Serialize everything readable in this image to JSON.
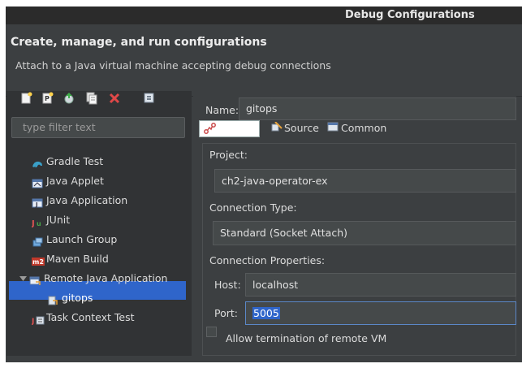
{
  "window": {
    "title": "Debug Configurations"
  },
  "header": {
    "title": "Create, manage, and run configurations",
    "subtitle": "Attach to a Java virtual machine accepting debug connections"
  },
  "toolbar": {
    "icons": [
      "new-configuration-icon",
      "new-prototype-icon",
      "export-icon",
      "duplicate-icon",
      "delete-icon",
      "collapse-all-icon"
    ],
    "delete_color": "#e04848"
  },
  "filter": {
    "placeholder": "type filter text"
  },
  "tree": {
    "items": [
      {
        "label": "Gradle Test",
        "icon": "gradle-icon"
      },
      {
        "label": "Java Applet",
        "icon": "java-applet-icon"
      },
      {
        "label": "Java Application",
        "icon": "java-application-icon"
      },
      {
        "label": "JUnit",
        "icon": "junit-icon"
      },
      {
        "label": "Launch Group",
        "icon": "launch-group-icon"
      },
      {
        "label": "Maven Build",
        "icon": "maven-icon"
      },
      {
        "label": "Remote Java Application",
        "icon": "remote-java-icon"
      },
      {
        "label": "gitops",
        "icon": "remote-config-icon"
      },
      {
        "label": "Task Context Test",
        "icon": "task-context-icon"
      }
    ]
  },
  "form": {
    "name_label": "Name:",
    "name_value": "gitops",
    "tabs": {
      "connect_icon": "connect-icon",
      "source": "Source",
      "common": "Common"
    },
    "project_label": "Project:",
    "project_value": "ch2-java-operator-ex",
    "connection_type_label": "Connection Type:",
    "connection_type_value": "Standard (Socket Attach)",
    "connection_props_label": "Connection Properties:",
    "host_label": "Host:",
    "host_value": "localhost",
    "port_label": "Port:",
    "port_value": "5005",
    "allow_termination_label": "Allow termination of remote VM"
  },
  "colors": {
    "selection": "#2f65ca",
    "background": "#3c3f41"
  }
}
